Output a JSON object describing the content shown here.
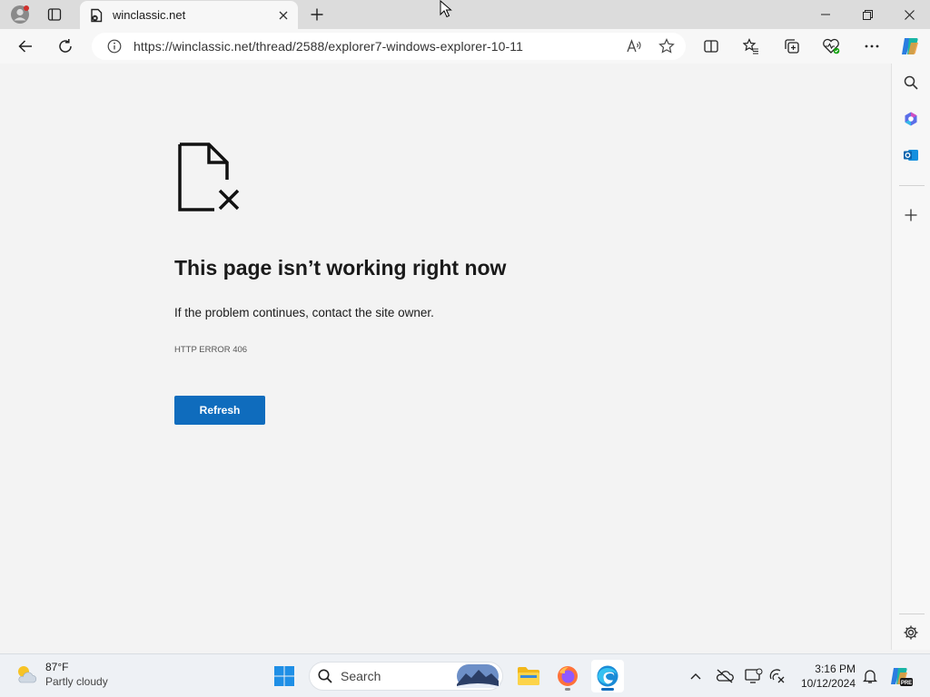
{
  "tab": {
    "title": "winclassic.net"
  },
  "address": {
    "url": "https://winclassic.net/thread/2588/explorer7-windows-explorer-10-11"
  },
  "error": {
    "title": "This page isn’t working right now",
    "message": "If the problem continues, contact the site owner.",
    "code": "HTTP ERROR 406",
    "refresh_label": "Refresh"
  },
  "taskbar": {
    "weather_temp": "87°F",
    "weather_condition": "Partly cloudy",
    "search_placeholder": "Search",
    "time": "3:16 PM",
    "date": "10/12/2024"
  },
  "colors": {
    "accent": "#0f6cbd",
    "tab_bar": "#dcdcdc",
    "page_bg": "#f3f3f3"
  }
}
